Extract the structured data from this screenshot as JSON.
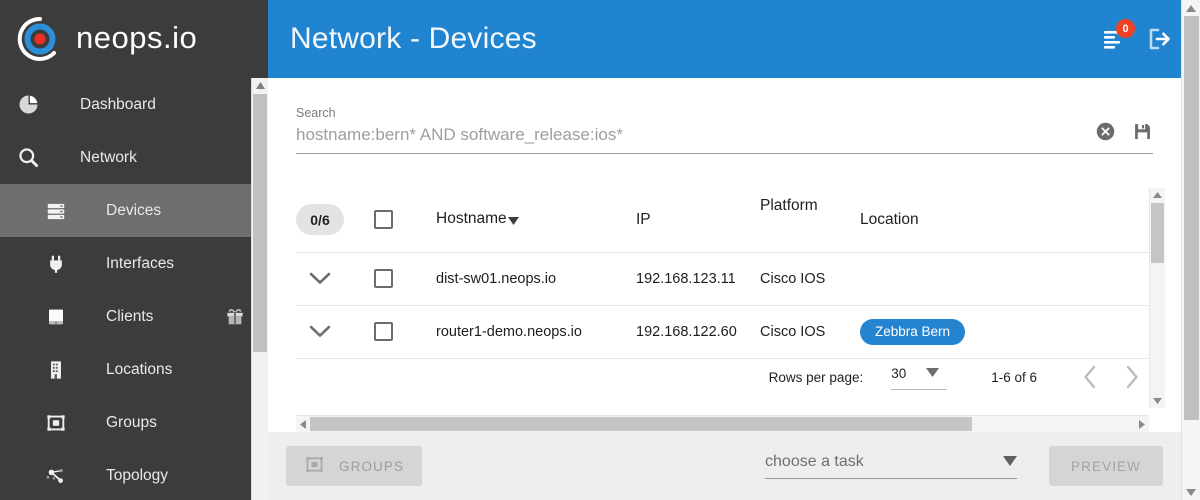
{
  "brand": {
    "name": "neops.io",
    "logo_icon": "neops-target-logo"
  },
  "sidebar": {
    "items": [
      {
        "label": "Dashboard",
        "icon": "pie-chart-icon",
        "level": 1,
        "active": false
      },
      {
        "label": "Network",
        "icon": "magnifier-icon",
        "level": 1,
        "active": false
      },
      {
        "label": "Devices",
        "icon": "server-stack-icon",
        "level": 2,
        "active": true
      },
      {
        "label": "Interfaces",
        "icon": "plug-icon",
        "level": 2,
        "active": false
      },
      {
        "label": "Clients",
        "icon": "tablet-icon",
        "level": 2,
        "active": false,
        "extra_icon": "gift-icon"
      },
      {
        "label": "Locations",
        "icon": "building-icon",
        "level": 2,
        "active": false
      },
      {
        "label": "Groups",
        "icon": "group-frame-icon",
        "level": 2,
        "active": false
      },
      {
        "label": "Topology",
        "icon": "topology-nodes-icon",
        "level": 2,
        "active": false
      }
    ]
  },
  "topbar": {
    "title": "Network - Devices",
    "tasks_icon": "task-list-icon",
    "tasks_badge": "0",
    "logout_icon": "logout-icon",
    "accent_color": "#2084d0",
    "badge_color": "#ef4123"
  },
  "search": {
    "label": "Search",
    "value": "hostname:bern* AND software_release:ios*",
    "placeholder": "hostname:bern* AND software_release:ios*",
    "clear_icon": "clear-circle-icon",
    "save_icon": "save-floppy-icon"
  },
  "table": {
    "selection_count": "0/6",
    "sort_column": "Hostname",
    "sort_direction": "desc",
    "columns": [
      "Hostname",
      "IP",
      "Platform",
      "Location"
    ],
    "rows": [
      {
        "expand_icon": "chevron-down-icon",
        "hostname": "dist-sw01.neops.io",
        "ip": "192.168.123.11",
        "platform": "Cisco IOS",
        "location": ""
      },
      {
        "expand_icon": "chevron-down-icon",
        "hostname": "router1-demo.neops.io",
        "ip": "192.168.122.60",
        "platform": "Cisco IOS",
        "location": "Zebbra Bern"
      }
    ]
  },
  "paginator": {
    "rows_per_page_label": "Rows per page:",
    "rows_per_page_value": "30",
    "range_label": "1-6 of 6",
    "prev_icon": "chevron-left-icon",
    "next_icon": "chevron-right-icon"
  },
  "bottombar": {
    "groups_label": "GROUPS",
    "groups_icon": "group-frame-icon",
    "task_placeholder": "choose a task",
    "task_dropdown_icon": "caret-down-icon",
    "preview_label": "PREVIEW"
  }
}
